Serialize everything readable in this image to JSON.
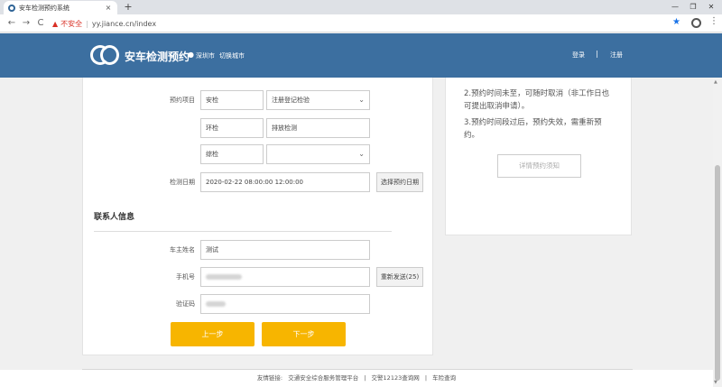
{
  "browser": {
    "tab_title": "安车检测预约系统",
    "tab_close": "×",
    "new_tab": "+",
    "minimize": "—",
    "maximize": "❐",
    "close": "✕",
    "back": "←",
    "forward": "→",
    "reload": "C",
    "security_warning": "不安全",
    "url": "yy.jiance.cn/index",
    "star": "★",
    "menu": "⋮"
  },
  "header": {
    "site_name": "安车检测预约",
    "city": "深圳市",
    "switch_city": "切换城市",
    "login": "登录",
    "separator": "|",
    "register": "注册"
  },
  "form": {
    "items_label": "预约项目",
    "rows": [
      {
        "category": "安检",
        "item": "注册登记检验",
        "has_dropdown": true
      },
      {
        "category": "环检",
        "item": "排放检测",
        "has_dropdown": false
      },
      {
        "category": "综检",
        "item": "",
        "has_dropdown": true
      }
    ],
    "date_label": "检测日期",
    "date_value": "2020-02-22 08:00:00 12:00:00",
    "date_button": "选择预约日期",
    "contact_title": "联系人信息",
    "owner_label": "车主姓名",
    "owner_value": "测试",
    "phone_label": "手机号",
    "resend_button": "重新发送(25)",
    "code_label": "验证码",
    "prev_button": "上一步",
    "next_button": "下一步"
  },
  "side": {
    "lines": [
      "2.预约时间未至，可随时取消（非工作日也",
      "可提出取消申请）。",
      "3.预约时间段过后，预约失效，需重新预",
      "约。"
    ],
    "detail_button": "详情预约须知"
  },
  "footer": {
    "prefix": "友情链接:",
    "links": [
      "交通安全综合服务管理平台",
      "交警12123查询网",
      "车险查询"
    ],
    "separator": "|"
  },
  "colors": {
    "header_bg": "#3c6fa0",
    "primary_button": "#f7b500",
    "warning": "#d93025"
  }
}
